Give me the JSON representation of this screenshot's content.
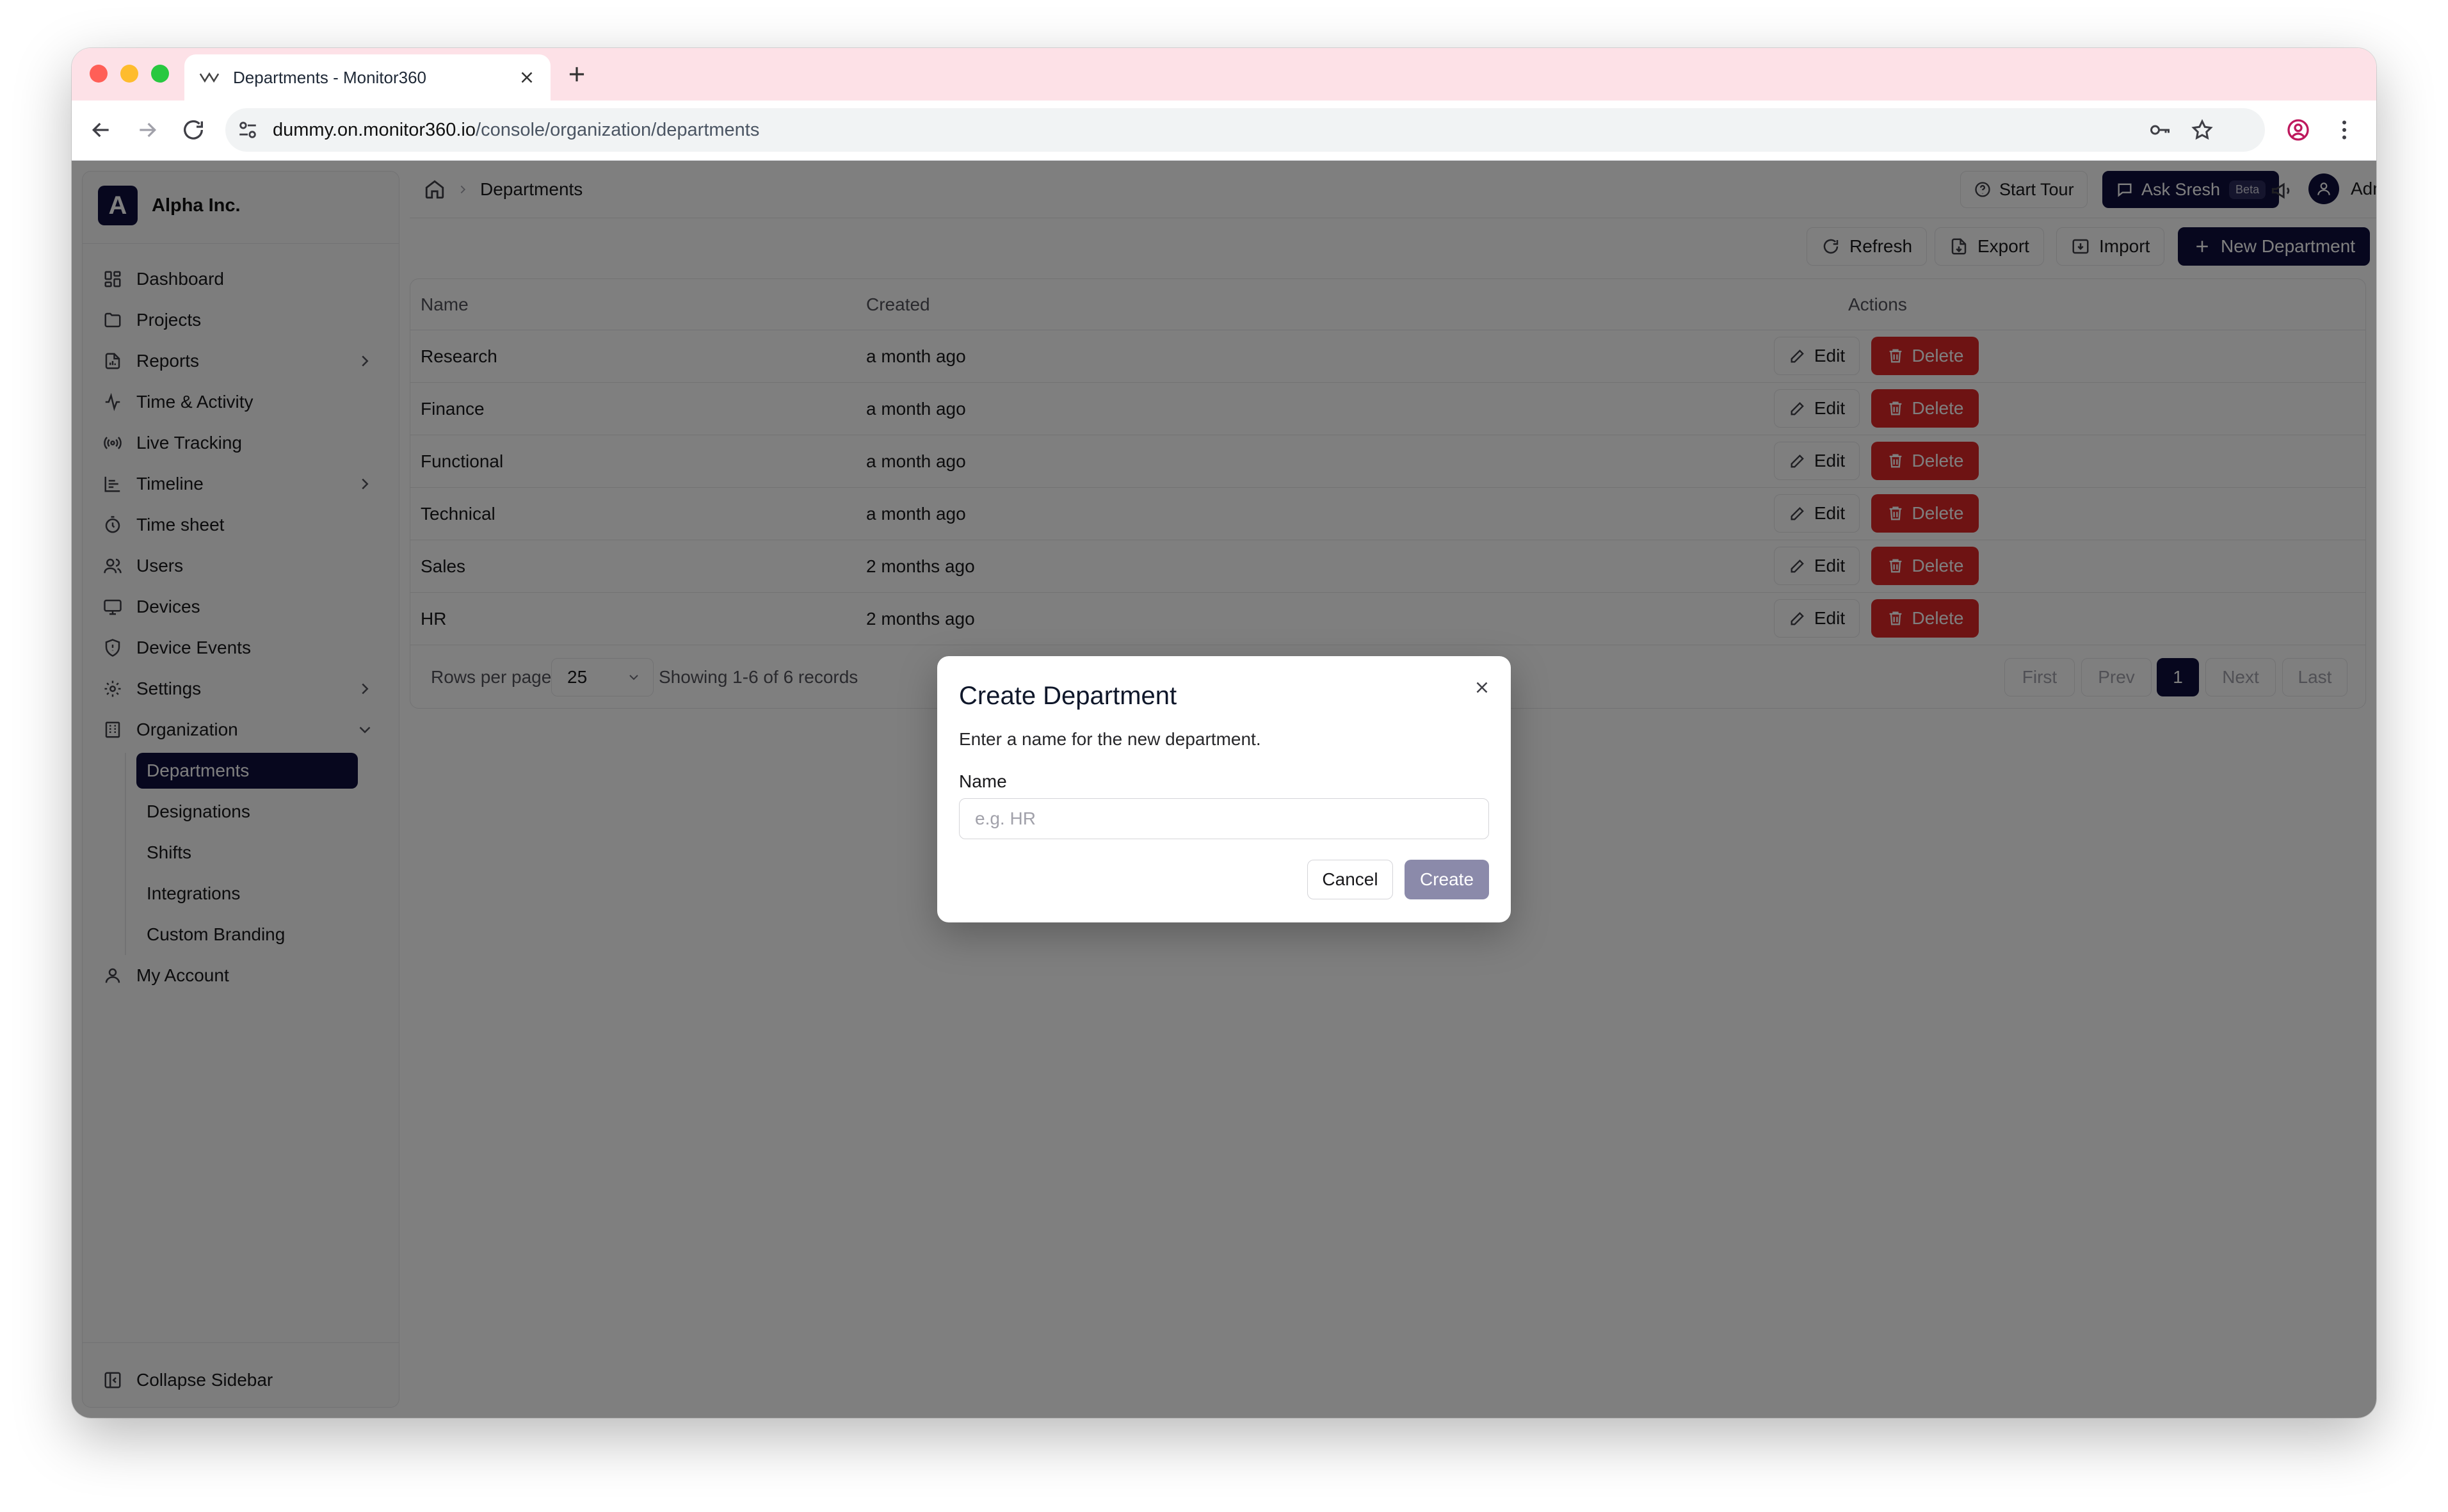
{
  "browser": {
    "tab_title": "Departments - Monitor360",
    "url_host": "dummy.on.monitor360.io",
    "url_path": "/console/organization/departments"
  },
  "sidebar": {
    "brand_initial": "A",
    "brand_name": "Alpha Inc.",
    "items": [
      {
        "label": "Dashboard",
        "icon": "dashboard-icon"
      },
      {
        "label": "Projects",
        "icon": "folder-icon"
      },
      {
        "label": "Reports",
        "icon": "report-icon"
      },
      {
        "label": "Time & Activity",
        "icon": "activity-icon"
      },
      {
        "label": "Live Tracking",
        "icon": "broadcast-icon"
      },
      {
        "label": "Timeline",
        "icon": "timeline-icon"
      },
      {
        "label": "Time sheet",
        "icon": "timer-icon"
      },
      {
        "label": "Users",
        "icon": "users-icon"
      },
      {
        "label": "Devices",
        "icon": "monitor-icon"
      },
      {
        "label": "Device Events",
        "icon": "shield-icon"
      },
      {
        "label": "Settings",
        "icon": "gear-icon"
      },
      {
        "label": "Organization",
        "icon": "building-icon"
      }
    ],
    "org_sub": [
      "Departments",
      "Designations",
      "Shifts",
      "Integrations",
      "Custom Branding"
    ],
    "my_account": "My Account",
    "collapse": "Collapse Sidebar"
  },
  "header": {
    "breadcrumb": "Departments",
    "start_tour": "Start Tour",
    "ask": "Ask Sresh",
    "beta": "Beta",
    "user": "Admin"
  },
  "actions": {
    "refresh": "Refresh",
    "export": "Export",
    "import": "Import",
    "new": "New Department"
  },
  "table": {
    "headers": {
      "name": "Name",
      "created": "Created",
      "actions": "Actions"
    },
    "rows": [
      {
        "name": "Research",
        "created": "a month ago"
      },
      {
        "name": "Finance",
        "created": "a month ago"
      },
      {
        "name": "Functional",
        "created": "a month ago"
      },
      {
        "name": "Technical",
        "created": "a month ago"
      },
      {
        "name": "Sales",
        "created": "2 months ago"
      },
      {
        "name": "HR",
        "created": "2 months ago"
      }
    ],
    "edit_label": "Edit",
    "delete_label": "Delete"
  },
  "pagination": {
    "rows_per_page_label": "Rows per page",
    "rows_per_page": "25",
    "showing": "Showing 1-6 of 6 records",
    "first": "First",
    "prev": "Prev",
    "current": "1",
    "next": "Next",
    "last": "Last"
  },
  "modal": {
    "title": "Create Department",
    "description": "Enter a name for the new department.",
    "field_label": "Name",
    "placeholder": "e.g. HR",
    "value": "",
    "cancel": "Cancel",
    "create": "Create"
  },
  "colors": {
    "primary": "#0f0f3d",
    "danger": "#dc2626",
    "tabstrip": "#fde1e7"
  }
}
